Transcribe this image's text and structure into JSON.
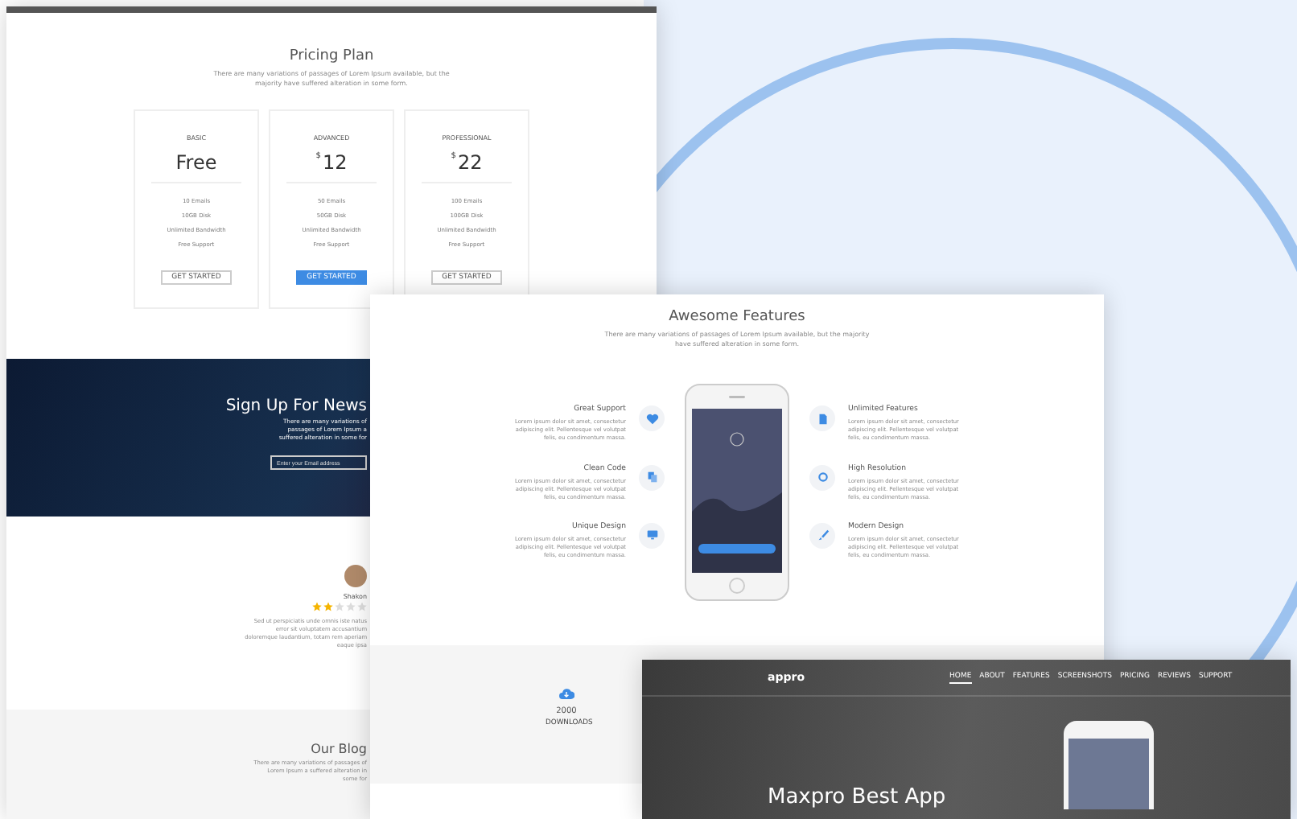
{
  "pricing_page": {
    "title": "Pricing Plan",
    "subtitle": "There are many variations of passages of Lorem Ipsum available, but the majority have suffered alteration in some form.",
    "plans": [
      {
        "name": "BASIC",
        "price": "Free",
        "features": [
          "10 Emails",
          "10GB Disk",
          "Unlimited Bandwidth",
          "Free Support"
        ],
        "button": "GET STARTED",
        "selected": false
      },
      {
        "name": "ADVANCED",
        "currency": "$",
        "price": "12",
        "features": [
          "50 Emails",
          "50GB Disk",
          "Unlimited Bandwidth",
          "Free Support"
        ],
        "button": "GET STARTED",
        "selected": true
      },
      {
        "name": "PROFESSIONAL",
        "currency": "$",
        "price": "22",
        "features": [
          "100 Emails",
          "100GB Disk",
          "Unlimited Bandwidth",
          "Free Support"
        ],
        "button": "GET STARTED",
        "selected": false
      }
    ],
    "newsletter": {
      "title": "Sign Up For News",
      "subtitle": "There are many variations of passages of Lorem Ipsum a suffered alteration in some for",
      "email_placeholder": "Enter your Email address"
    },
    "testimonial": {
      "name": "Shakon",
      "stars": 2,
      "quote": "Sed ut perspiciatis unde omnis iste natus error sit voluptatem accusantium doloremque laudantium, totam rem aperiam eaque ipsa"
    },
    "blog": {
      "title": "Our Blog",
      "subtitle": "There are many variations of passages of Lorem Ipsum a suffered alteration in some for"
    }
  },
  "features_page": {
    "title": "Awesome Features",
    "subtitle": "There are many variations of passages of Lorem Ipsum available, but the majority have suffered alteration in some form.",
    "left_features": [
      {
        "title": "Great Support",
        "text": "Lorem ipsum dolor sit amet, consectetur adipiscing elit. Pellentesque vel volutpat felis, eu condimentum massa."
      },
      {
        "title": "Clean Code",
        "text": "Lorem ipsum dolor sit amet, consectetur adipiscing elit. Pellentesque vel volutpat felis, eu condimentum massa."
      },
      {
        "title": "Unique Design",
        "text": "Lorem ipsum dolor sit amet, consectetur adipiscing elit. Pellentesque vel volutpat felis, eu condimentum massa."
      }
    ],
    "right_features": [
      {
        "title": "Unlimited Features",
        "text": "Lorem ipsum dolor sit amet, consectetur adipiscing elit. Pellentesque vel volutpat felis, eu condimentum massa."
      },
      {
        "title": "High Resolution",
        "text": "Lorem ipsum dolor sit amet, consectetur adipiscing elit. Pellentesque vel volutpat felis, eu condimentum massa."
      },
      {
        "title": "Modern Design",
        "text": "Lorem ipsum dolor sit amet, consectetur adipiscing elit. Pellentesque vel volutpat felis, eu condimentum massa."
      }
    ],
    "downloads": {
      "count": "2000",
      "label": "DOWNLOADS"
    }
  },
  "app_page": {
    "logo": "appro",
    "nav": [
      {
        "label": "HOME",
        "selected": true
      },
      {
        "label": "ABOUT",
        "selected": false
      },
      {
        "label": "FEATURES",
        "selected": false
      },
      {
        "label": "SCREENSHOTS",
        "selected": false
      },
      {
        "label": "PRICING",
        "selected": false
      },
      {
        "label": "REVIEWS",
        "selected": false
      },
      {
        "label": "SUPPORT",
        "selected": false
      }
    ],
    "headline": "Maxpro Best App"
  }
}
